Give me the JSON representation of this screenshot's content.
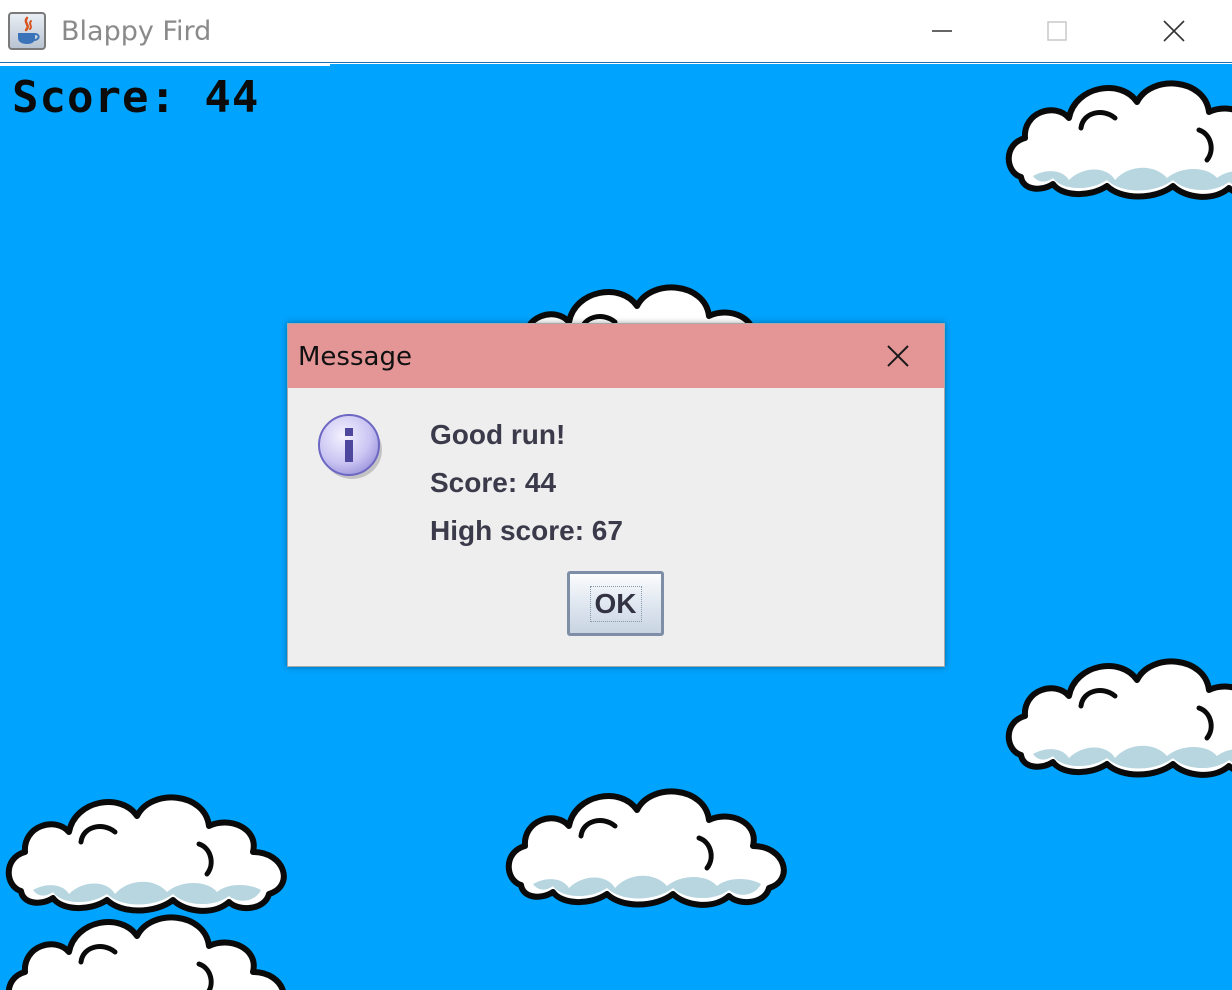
{
  "window": {
    "title": "Blappy Fird",
    "controls": [
      "minimize-icon",
      "maximize-icon",
      "close-icon"
    ]
  },
  "game": {
    "score_text": "Score: 44",
    "sky_color": "#00a3fd",
    "cloud_color": "#ffffff",
    "cloud_shade_color": "#b7d6e0"
  },
  "dialog": {
    "title": "Message",
    "title_bar_color": "#e49596",
    "icon": "info-icon",
    "lines": [
      "Good run!",
      "Score: 44",
      "High score: 67"
    ],
    "ok_label": "OK"
  }
}
